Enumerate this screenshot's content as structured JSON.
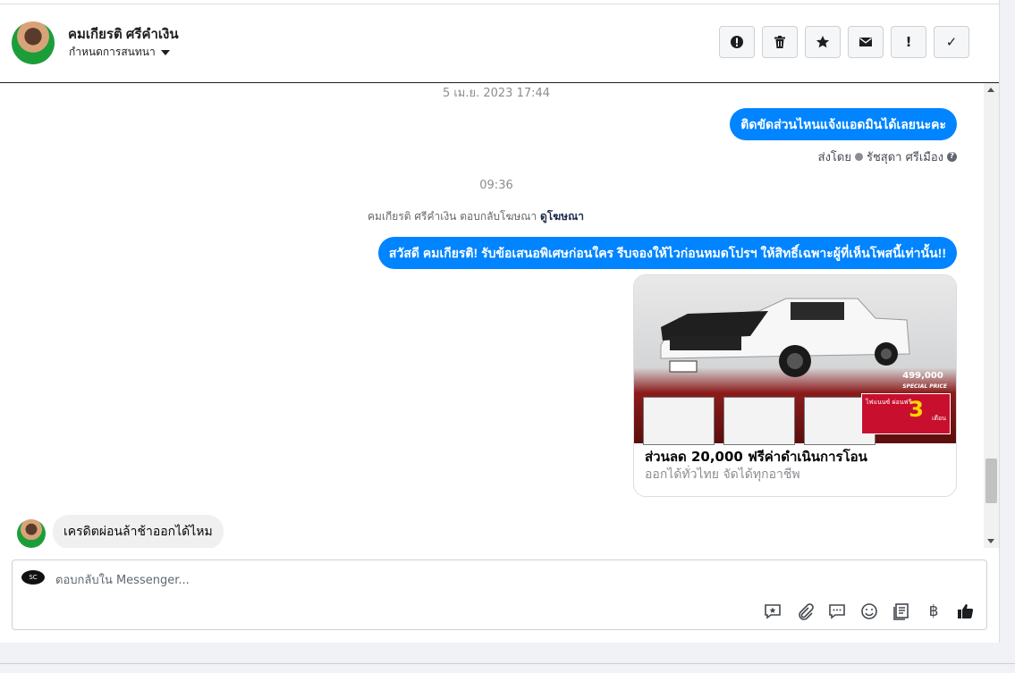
{
  "header": {
    "name": "คมเกียรติ ศรีคำเงิน",
    "subtitle": "กำหนดการสนทนา"
  },
  "actions": [
    {
      "icon": "alert-circle-icon"
    },
    {
      "icon": "trash-icon"
    },
    {
      "icon": "star-icon"
    },
    {
      "icon": "envelope-icon"
    },
    {
      "icon": "exclamation-icon",
      "label": "!"
    },
    {
      "icon": "checkmark-icon",
      "label": "✓"
    }
  ],
  "thread": {
    "timestamp1": "5 เม.ย. 2023 17:44",
    "msg1": "ติดขัดส่วนไหนแจ้งแอดมินได้เลยนะคะ",
    "sent_by_label": "ส่งโดย",
    "sent_by_name": "รัชสุดา ศรีเมือง",
    "timestamp2": "09:36",
    "ad_reply_text": "คมเกียรติ ศรีคำเงิน ตอบกลับโฆษณา",
    "ad_reply_link": "ดูโฆษณา",
    "msg2": "สวัสดี คมเกียรติ! รับข้อเสนอพิเศษก่อนใคร รีบจองให้ไวก่อนหมดโปรฯ ให้สิทธิ์เฉพาะผู้ที่เห็นโพสนี้เท่านั้น!!",
    "card": {
      "price_text": "499,000",
      "price_sub": "SPECIAL PRICE",
      "promo_label": "ไฟแนนซ์ ผ่อนฟรี",
      "promo_num": "3",
      "promo_unit": "เดือน",
      "title": "ส่วนลด 20,000 ฟรีค่าดำเนินการโอน",
      "subtitle": "ออกได้ทั่วไทย จัดได้ทุกอาชีพ"
    },
    "incoming": "เครดิตผ่อนล้าช้าออกได้ไหม"
  },
  "composer": {
    "placeholder": "ตอบกลับใน Messenger...",
    "logo_text": "SC"
  },
  "colors": {
    "accent": "#0084ff",
    "incoming_bg": "#f0f0f0"
  }
}
